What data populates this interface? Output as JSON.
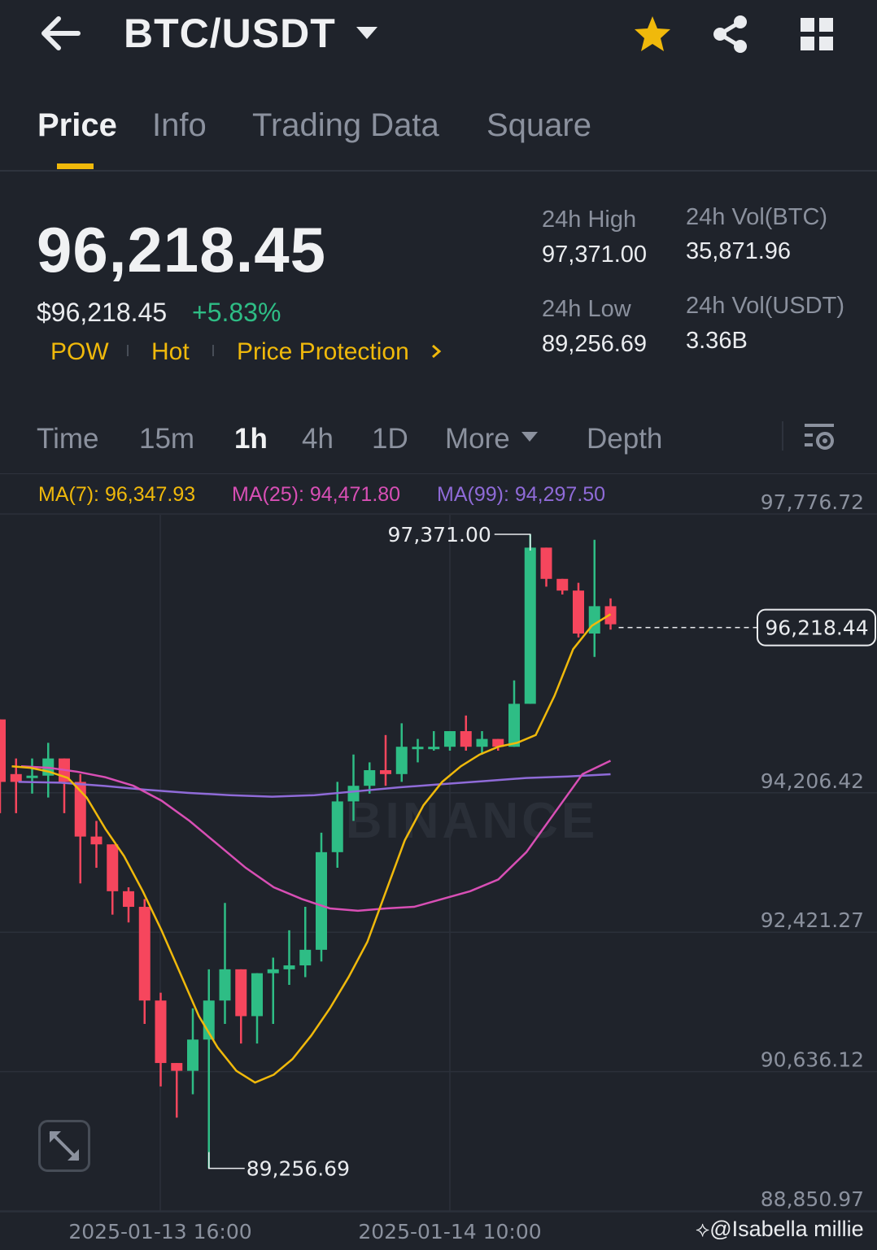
{
  "header": {
    "pair": "BTC/USDT",
    "icons": [
      "back-arrow-icon",
      "caret-down-icon",
      "star-icon",
      "share-icon",
      "grid-icon"
    ],
    "star_color": "#f0b90b"
  },
  "tabs": [
    {
      "label": "Price",
      "active": true
    },
    {
      "label": "Info",
      "active": false
    },
    {
      "label": "Trading Data",
      "active": false
    },
    {
      "label": "Square",
      "active": false
    }
  ],
  "ticker": {
    "last_price": "96,218.45",
    "usd_price": "$96,218.45",
    "change": "+5.83%",
    "tags": [
      "POW",
      "Hot",
      "Price Protection"
    ],
    "stats": {
      "high_label": "24h High",
      "high_value": "97,371.00",
      "low_label": "24h Low",
      "low_value": "89,256.69",
      "vol_btc_label": "24h Vol(BTC)",
      "vol_btc_value": "35,871.96",
      "vol_usdt_label": "24h Vol(USDT)",
      "vol_usdt_value": "3.36B"
    }
  },
  "intervals": {
    "items": [
      "Time",
      "15m",
      "1h",
      "4h",
      "1D",
      "More",
      "Depth"
    ],
    "active": "1h"
  },
  "ma_legend": {
    "ma7": "MA(7): 96,347.93",
    "ma25": "MA(25): 94,471.80",
    "ma99": "MA(99): 94,297.50"
  },
  "colors": {
    "up": "#2ebd85",
    "down": "#f6465d",
    "ma7": "#f0b90b",
    "ma25": "#d84fb5",
    "ma99": "#8f6bd8",
    "accent": "#f0b90b",
    "background": "#1f232b"
  },
  "chart_data": {
    "type": "candlestick",
    "y_tick_labels": [
      "97,776.72",
      "94,206.42",
      "92,421.27",
      "90,636.12",
      "88,850.97"
    ],
    "y_ticks": [
      97776.72,
      94206.42,
      92421.27,
      90636.12,
      88850.97
    ],
    "ylim": [
      88850.97,
      97776.72
    ],
    "x_tick_labels": [
      "2025-01-13 16:00",
      "2025-01-14 10:00"
    ],
    "current_price_label": "96,218.44",
    "current_price": 96218.44,
    "max_label": "97,371.00",
    "min_label": "89,256.69",
    "watermark": "BINANCE",
    "candles": [
      {
        "o": 95000,
        "h": 95000,
        "l": 93800,
        "c": 94200
      },
      {
        "o": 94300,
        "h": 94500,
        "l": 93800,
        "c": 94200
      },
      {
        "o": 94250,
        "h": 94500,
        "l": 94050,
        "c": 94280
      },
      {
        "o": 94280,
        "h": 94700,
        "l": 94000,
        "c": 94500
      },
      {
        "o": 94500,
        "h": 94500,
        "l": 93800,
        "c": 94200
      },
      {
        "o": 94200,
        "h": 94300,
        "l": 92900,
        "c": 93500
      },
      {
        "o": 93500,
        "h": 93700,
        "l": 93100,
        "c": 93400
      },
      {
        "o": 93400,
        "h": 93400,
        "l": 92500,
        "c": 92800
      },
      {
        "o": 92800,
        "h": 92850,
        "l": 92400,
        "c": 92600
      },
      {
        "o": 92600,
        "h": 92700,
        "l": 91100,
        "c": 91400
      },
      {
        "o": 91400,
        "h": 91500,
        "l": 90300,
        "c": 90600
      },
      {
        "o": 90600,
        "h": 90600,
        "l": 89900,
        "c": 90500
      },
      {
        "o": 90500,
        "h": 91300,
        "l": 90200,
        "c": 90900
      },
      {
        "o": 90900,
        "h": 91800,
        "l": 89250,
        "c": 91400
      },
      {
        "o": 91400,
        "h": 92650,
        "l": 91100,
        "c": 91800
      },
      {
        "o": 91800,
        "h": 91800,
        "l": 90850,
        "c": 91200
      },
      {
        "o": 91200,
        "h": 91750,
        "l": 90850,
        "c": 91750
      },
      {
        "o": 91750,
        "h": 91950,
        "l": 91100,
        "c": 91800
      },
      {
        "o": 91800,
        "h": 92300,
        "l": 91600,
        "c": 91850
      },
      {
        "o": 91850,
        "h": 92600,
        "l": 91700,
        "c": 92050
      },
      {
        "o": 92050,
        "h": 93550,
        "l": 91900,
        "c": 93300
      },
      {
        "o": 93300,
        "h": 94200,
        "l": 93100,
        "c": 93950
      },
      {
        "o": 93950,
        "h": 94550,
        "l": 93700,
        "c": 94150
      },
      {
        "o": 94150,
        "h": 94450,
        "l": 94050,
        "c": 94350
      },
      {
        "o": 94350,
        "h": 94800,
        "l": 94150,
        "c": 94300
      },
      {
        "o": 94300,
        "h": 94950,
        "l": 94200,
        "c": 94650
      },
      {
        "o": 94650,
        "h": 94750,
        "l": 94450,
        "c": 94650
      },
      {
        "o": 94650,
        "h": 94850,
        "l": 94600,
        "c": 94650
      },
      {
        "o": 94650,
        "h": 94850,
        "l": 94600,
        "c": 94850
      },
      {
        "o": 94850,
        "h": 95050,
        "l": 94600,
        "c": 94650
      },
      {
        "o": 94650,
        "h": 94850,
        "l": 94550,
        "c": 94750
      },
      {
        "o": 94750,
        "h": 94750,
        "l": 94600,
        "c": 94650
      },
      {
        "o": 94650,
        "h": 95500,
        "l": 94650,
        "c": 95200
      },
      {
        "o": 95200,
        "h": 97371,
        "l": 95200,
        "c": 97200
      },
      {
        "o": 97200,
        "h": 97200,
        "l": 96700,
        "c": 96800
      },
      {
        "o": 96800,
        "h": 96800,
        "l": 96600,
        "c": 96650
      },
      {
        "o": 96650,
        "h": 96750,
        "l": 96050,
        "c": 96100
      },
      {
        "o": 96100,
        "h": 97300,
        "l": 95800,
        "c": 96450
      },
      {
        "o": 96450,
        "h": 96550,
        "l": 96150,
        "c": 96218.44
      }
    ],
    "ma7": [
      94400,
      94380,
      94330,
      94250,
      94000,
      93600,
      93250,
      92800,
      92300,
      91750,
      91200,
      90800,
      90500,
      90350,
      90450,
      90650,
      90950,
      91300,
      91700,
      92150,
      92800,
      93450,
      93900,
      94200,
      94400,
      94550,
      94650,
      94700,
      94800,
      95300,
      95900,
      96200,
      96347.93
    ],
    "ma25": [
      94400,
      94380,
      94330,
      94260,
      94150,
      93960,
      93700,
      93400,
      93100,
      92850,
      92700,
      92580,
      92550,
      92580,
      92600,
      92700,
      92800,
      92950,
      93300,
      93800,
      94300,
      94471.8
    ],
    "ma99": [
      94200,
      94190,
      94150,
      94100,
      94060,
      94030,
      94010,
      94030,
      94080,
      94130,
      94170,
      94210,
      94250,
      94270,
      94297.5
    ]
  },
  "watermark_user": "@Isabella millie"
}
